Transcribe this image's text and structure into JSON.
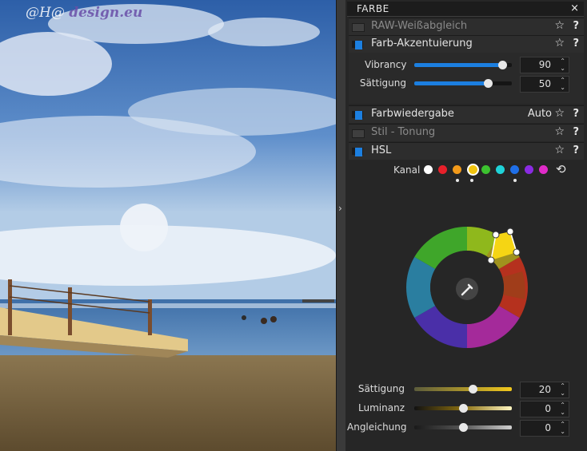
{
  "watermark": {
    "prefix": "@H@ ",
    "brand": "design.eu"
  },
  "panel": {
    "title": "FARBE",
    "close": "×",
    "sections": {
      "raw": {
        "label": "RAW-Weißabgleich",
        "enabled": false
      },
      "akzent": {
        "label": "Farb-Akzentuierung",
        "enabled": true
      },
      "wiedergabe": {
        "label": "Farbwiedergabe",
        "enabled": true,
        "auto": "Auto"
      },
      "stil": {
        "label": "Stil - Tonung",
        "enabled": false
      },
      "hsl": {
        "label": "HSL",
        "enabled": true
      }
    },
    "icons": {
      "star": "☆",
      "help": "?",
      "spin_up": "⌃",
      "spin_down": "⌄"
    },
    "akzent_sliders": {
      "vibrancy": {
        "label": "Vibrancy",
        "value": "90",
        "level": 0.9
      },
      "saettigung": {
        "label": "Sättigung",
        "value": "50",
        "level": 0.75
      }
    },
    "hsl": {
      "kanal_label": "Kanal",
      "channels": [
        {
          "name": "white",
          "color": "#ffffff",
          "marked": false
        },
        {
          "name": "red",
          "color": "#e8202a",
          "marked": false
        },
        {
          "name": "orange",
          "color": "#f29a1a",
          "marked": true
        },
        {
          "name": "yellow",
          "color": "#f1c40f",
          "marked": true,
          "selected": true
        },
        {
          "name": "green",
          "color": "#3cc22f",
          "marked": false
        },
        {
          "name": "cyan",
          "color": "#1fd3d8",
          "marked": false
        },
        {
          "name": "blue",
          "color": "#1f6fe8",
          "marked": true
        },
        {
          "name": "purple",
          "color": "#8a2be2",
          "marked": false
        },
        {
          "name": "magenta",
          "color": "#e02bc8",
          "marked": false
        }
      ],
      "sliders": {
        "saettigung": {
          "label": "Sättigung",
          "value": "20",
          "level": 0.6
        },
        "luminanz": {
          "label": "Luminanz",
          "value": "0",
          "level": 0.5
        },
        "angleichung": {
          "label": "Angleichung",
          "value": "0",
          "level": 0.5
        }
      }
    },
    "colors": {
      "accent": "#1c7fe0",
      "panel_bg": "#262626"
    }
  }
}
